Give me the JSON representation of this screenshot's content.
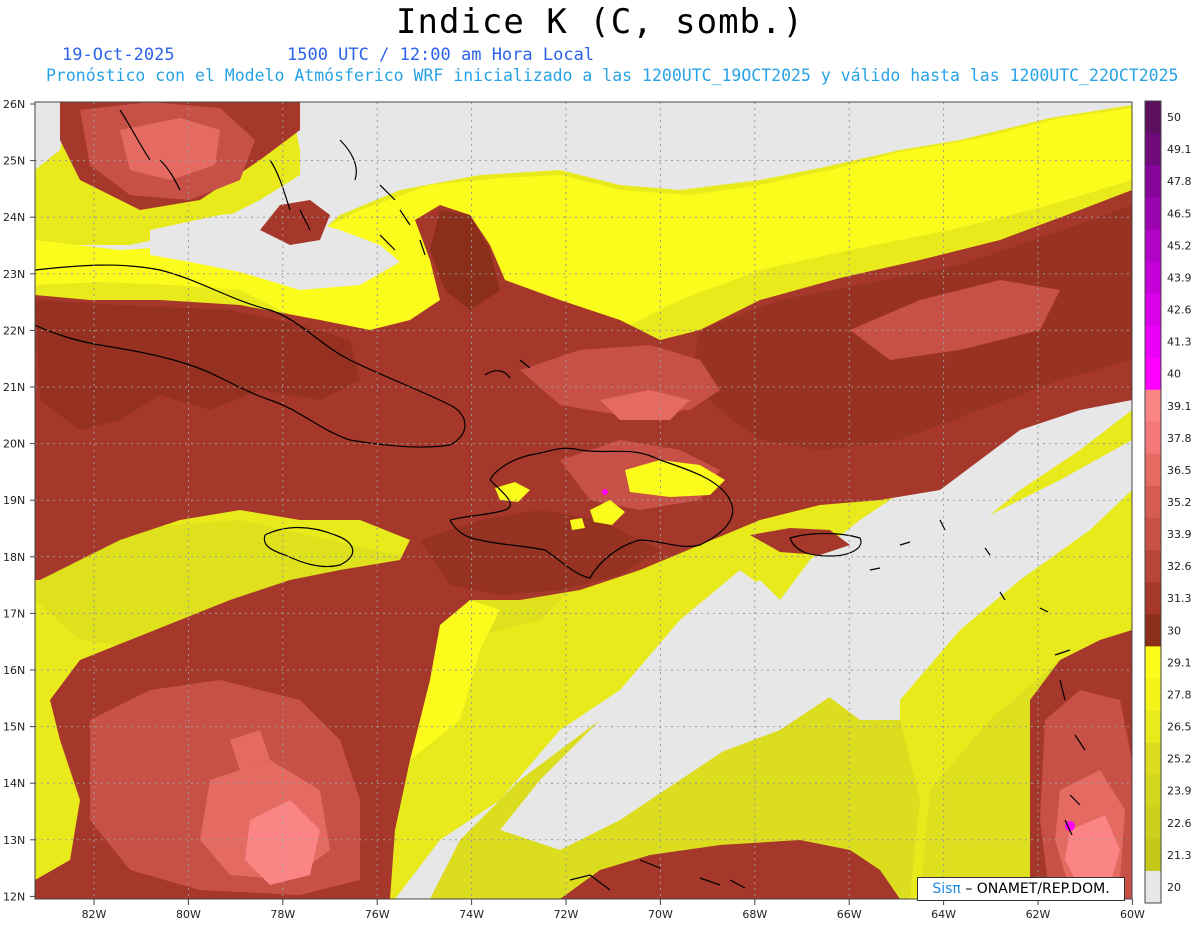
{
  "title": "Indice K (C, somb.)",
  "date": "19-Oct-2025",
  "time": "1500 UTC / 12:00 am Hora Local",
  "forecast": "Pronóstico con el Modelo Atmósferico WRF inicializado a las 1200UTC_19OCT2025 y válido hasta las  1200UTC_22OCT2025",
  "credit": {
    "logo": "Sisπ",
    "text": "– ONAMET/REP.DOM."
  },
  "lat_labels": [
    "26N",
    "25N",
    "24N",
    "23N",
    "22N",
    "21N",
    "20N",
    "19N",
    "18N",
    "17N",
    "16N",
    "15N",
    "14N",
    "13N",
    "12N"
  ],
  "lon_labels": [
    "82W",
    "80W",
    "78W",
    "76W",
    "74W",
    "72W",
    "70W",
    "68W",
    "66W",
    "64W",
    "62W",
    "60W"
  ],
  "colorbar": {
    "labels": [
      "50",
      "49.1",
      "47.8",
      "46.5",
      "45.2",
      "43.9",
      "42.6",
      "41.3",
      "40",
      "39.1",
      "37.8",
      "36.5",
      "35.2",
      "33.9",
      "32.6",
      "31.3",
      "30",
      "29.1",
      "27.8",
      "26.5",
      "25.2",
      "23.9",
      "22.6",
      "21.3",
      "20"
    ],
    "colors": [
      "#5c0f5e",
      "#6e0a7a",
      "#86069a",
      "#9a05b0",
      "#b103c6",
      "#c600d9",
      "#d900ea",
      "#ec00f7",
      "#ff00ff",
      "#fb8585",
      "#f47878",
      "#e56a62",
      "#d65c52",
      "#c85147",
      "#b9443a",
      "#a5372b",
      "#8b2e1a",
      "#fbfb1c",
      "#f4f41a",
      "#e8ea1c",
      "#dcdd1e",
      "#d4d61e",
      "#cccf1e",
      "#c4c819",
      "#e7e7e7"
    ]
  },
  "legend_colors": {
    "no_data": "#e7e7e7",
    "low": "#e8ea1c",
    "mid": "#c85147",
    "high": "#fb8585",
    "extreme": "#ff00ff"
  }
}
